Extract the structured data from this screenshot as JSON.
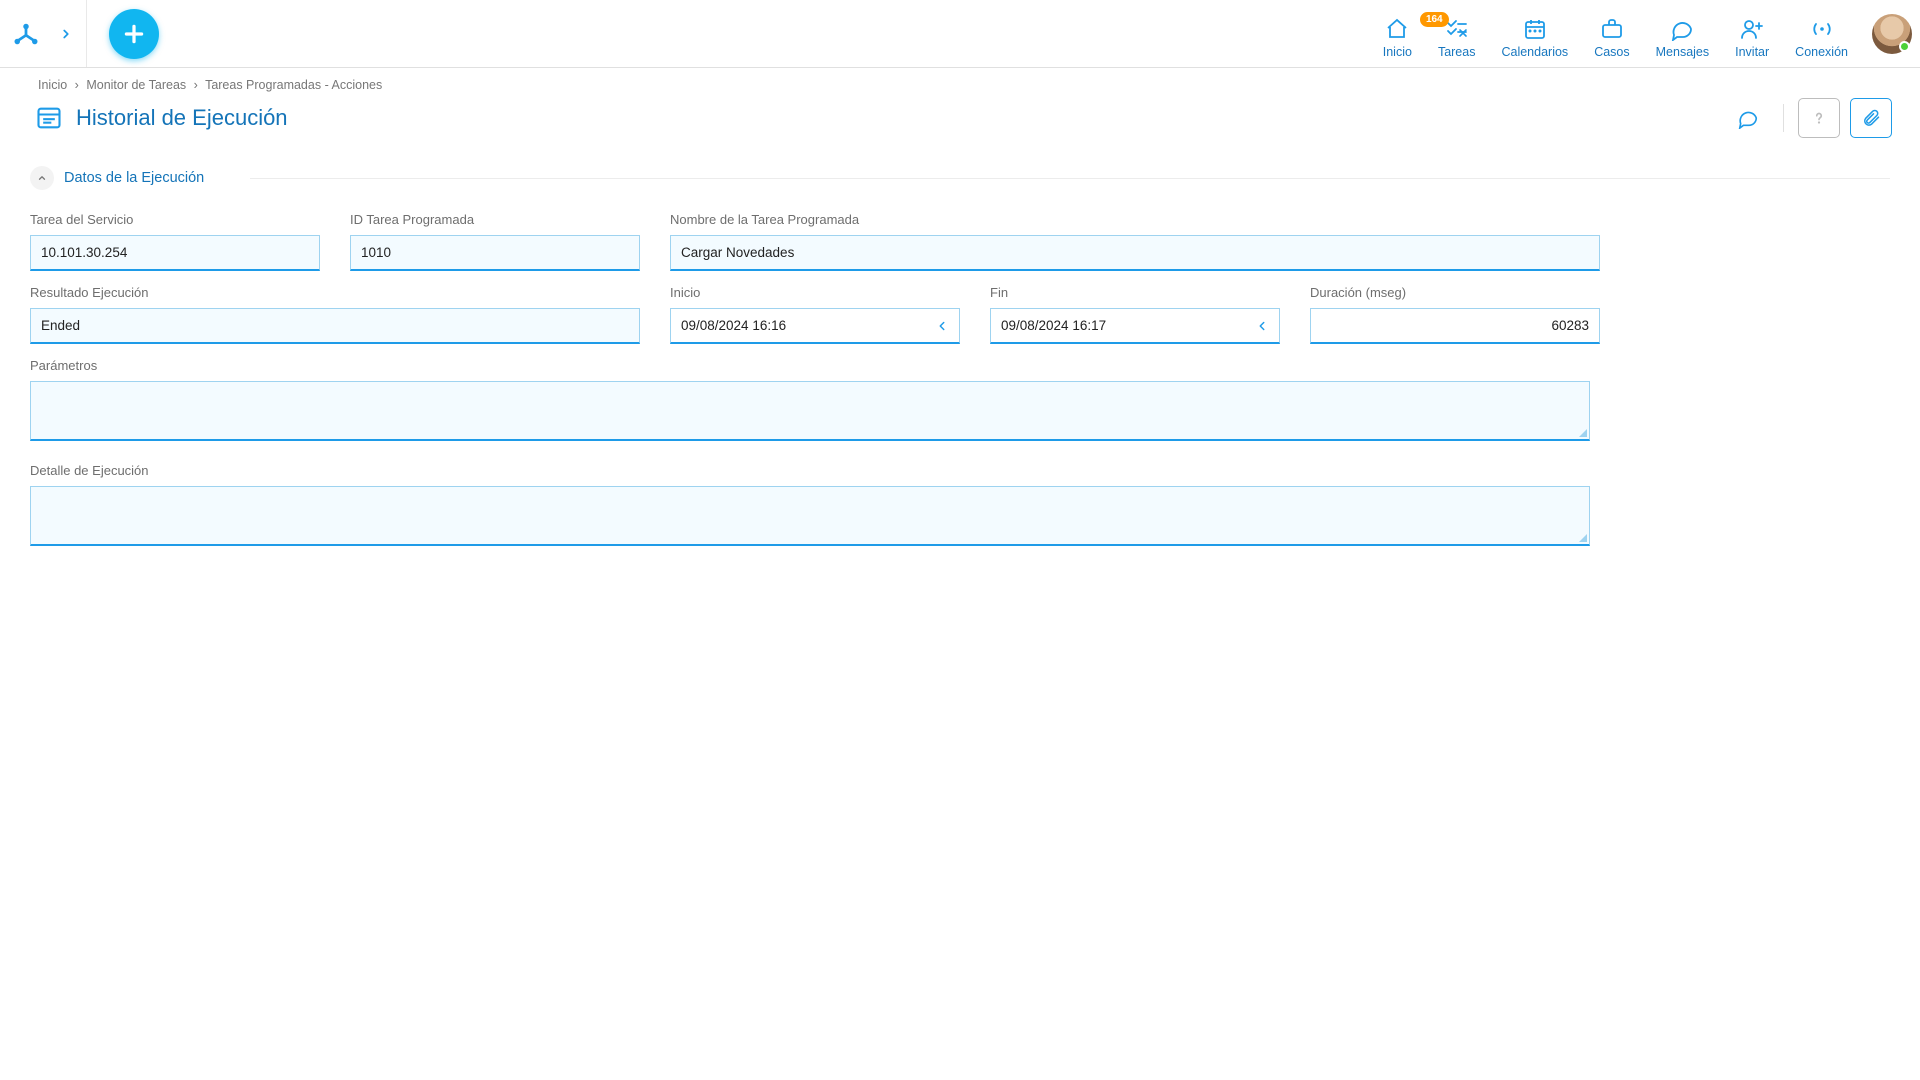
{
  "nav": {
    "home": {
      "label": "Inicio"
    },
    "tasks": {
      "label": "Tareas",
      "badge": "164"
    },
    "cal": {
      "label": "Calendarios"
    },
    "cases": {
      "label": "Casos"
    },
    "msgs": {
      "label": "Mensajes"
    },
    "invite": {
      "label": "Invitar"
    },
    "conn": {
      "label": "Conexión"
    }
  },
  "breadcrumb": {
    "home": "Inicio",
    "monitor": "Monitor de Tareas",
    "actions": "Tareas Programadas - Acciones"
  },
  "page": {
    "title": "Historial de Ejecución"
  },
  "section": {
    "title": "Datos de la Ejecución"
  },
  "form": {
    "serviceTask": {
      "label": "Tarea del Servicio",
      "value": "10.101.30.254"
    },
    "schedTaskId": {
      "label": "ID Tarea Programada",
      "value": "1010"
    },
    "schedTaskName": {
      "label": "Nombre de la Tarea Programada",
      "value": "Cargar Novedades"
    },
    "execResult": {
      "label": "Resultado Ejecución",
      "value": "Ended"
    },
    "start": {
      "label": "Inicio",
      "value": "09/08/2024 16:16"
    },
    "end": {
      "label": "Fin",
      "value": "09/08/2024 16:17"
    },
    "duration": {
      "label": "Duración (mseg)",
      "value": "60283"
    },
    "params": {
      "label": "Parámetros",
      "value": ""
    },
    "detail": {
      "label": "Detalle de Ejecución",
      "value": ""
    }
  }
}
